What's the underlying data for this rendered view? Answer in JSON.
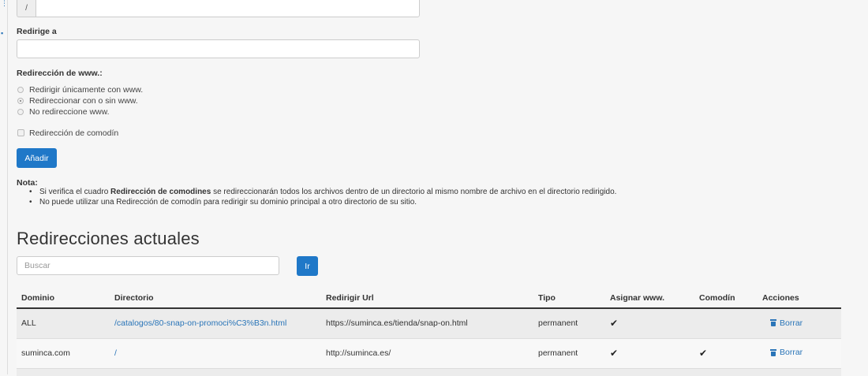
{
  "form": {
    "path_prefix": "/",
    "redirect_to_label": "Redirige a",
    "www_redirect_label": "Redirección de www.:",
    "www_options": [
      {
        "label": "Redirigir únicamente con www.",
        "checked": false
      },
      {
        "label": "Redireccionar con o sin www.",
        "checked": true
      },
      {
        "label": "No redireccione www.",
        "checked": false
      }
    ],
    "wildcard_label": "Redirección de comodín",
    "add_button": "Añadir"
  },
  "note": {
    "label": "Nota:",
    "item1_before": "Si verifica el cuadro ",
    "item1_bold": "Redirección de comodines",
    "item1_after": " se redireccionarán todos los archivos dentro de un directorio al mismo nombre de archivo en el directorio redirigido.",
    "item2": "No puede utilizar una Redirección de comodín para redirigir su dominio principal a otro directorio de su sitio."
  },
  "current": {
    "title": "Redirecciones actuales",
    "search_placeholder": "Buscar",
    "go_button": "Ir"
  },
  "table": {
    "headers": {
      "domain": "Dominio",
      "directory": "Directorio",
      "redirect_url": "Redirigir Url",
      "type": "Tipo",
      "assign_www": "Asignar www.",
      "wildcard": "Comodín",
      "actions": "Acciones"
    },
    "rows": [
      {
        "domain": "ALL",
        "directory": "/catalogos/80-snap-on-promoci%C3%B3n.html",
        "redirect_url": "https://suminca.es/tienda/snap-on.html",
        "type": "permanent",
        "assign_www": "✔",
        "wildcard": "",
        "action": "Borrar"
      },
      {
        "domain": "suminca.com",
        "directory": "/",
        "redirect_url": "http://suminca.es/",
        "type": "permanent",
        "assign_www": "✔",
        "wildcard": "✔",
        "action": "Borrar"
      }
    ]
  },
  "colors": {
    "accent": "#1f78c8",
    "link": "#2a75b8"
  }
}
